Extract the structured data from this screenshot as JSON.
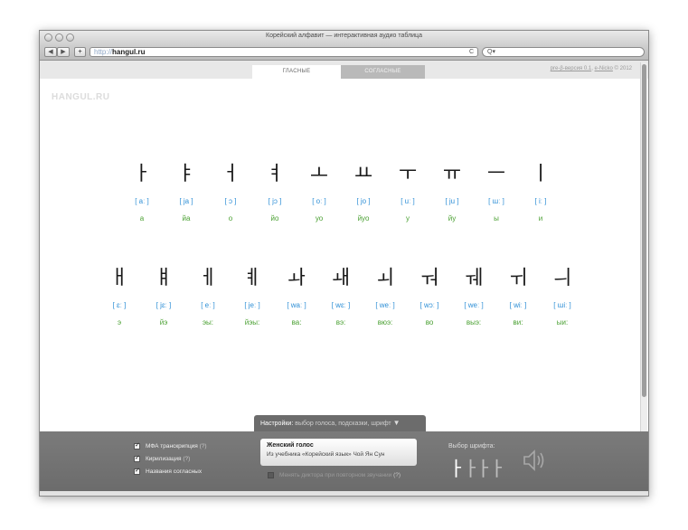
{
  "browser": {
    "window_title": "Корейский алфавит — интерактивная аудио таблица",
    "back_label": "◀",
    "forward_label": "▶",
    "add_label": "+",
    "url_protocol": "http://",
    "url_host": "hangul.ru",
    "reload_label": "C",
    "search_placeholder": "Q▾"
  },
  "header": {
    "tab_vowels": "ГЛАСНЫЕ",
    "tab_consonants": "СОГЛАСНЫЕ",
    "version_link": "pre-β-версия 0.1",
    "version_sep": ", ",
    "author_link": "e-Nicko",
    "copyright": " © 2012",
    "logo": "HANGUL.RU"
  },
  "row1": [
    {
      "jamo": "ㅏ",
      "ipa": "[ aː ]",
      "cyr": "а"
    },
    {
      "jamo": "ㅑ",
      "ipa": "[ ja ]",
      "cyr": "йа"
    },
    {
      "jamo": "ㅓ",
      "ipa": "[ ɔ ]",
      "cyr": "о"
    },
    {
      "jamo": "ㅕ",
      "ipa": "[ jɔ ]",
      "cyr": "йо"
    },
    {
      "jamo": "ㅗ",
      "ipa": "[ oː ]",
      "cyr": "уо"
    },
    {
      "jamo": "ㅛ",
      "ipa": "[ jo ]",
      "cyr": "йуо"
    },
    {
      "jamo": "ㅜ",
      "ipa": "[ uː ]",
      "cyr": "у"
    },
    {
      "jamo": "ㅠ",
      "ipa": "[ ju ]",
      "cyr": "йу"
    },
    {
      "jamo": "ㅡ",
      "ipa": "[ ɯː ]",
      "cyr": "ы"
    },
    {
      "jamo": "ㅣ",
      "ipa": "[ iː ]",
      "cyr": "и"
    }
  ],
  "row2": [
    {
      "jamo": "ㅐ",
      "ipa": "[ ɛː ]",
      "cyr": "э"
    },
    {
      "jamo": "ㅒ",
      "ipa": "[ jɛː ]",
      "cyr": "йэ"
    },
    {
      "jamo": "ㅔ",
      "ipa": "[ eː ]",
      "cyr": "эы:"
    },
    {
      "jamo": "ㅖ",
      "ipa": "[ jeː ]",
      "cyr": "йэы:"
    },
    {
      "jamo": "ㅘ",
      "ipa": "[ waː ]",
      "cyr": "ва:"
    },
    {
      "jamo": "ㅙ",
      "ipa": "[ wɛː ]",
      "cyr": "вэ:"
    },
    {
      "jamo": "ㅚ",
      "ipa": "[ weː ]",
      "cyr": "вюэ:"
    },
    {
      "jamo": "ㅝ",
      "ipa": "[ wɔː ]",
      "cyr": "во"
    },
    {
      "jamo": "ㅞ",
      "ipa": "[ weː ]",
      "cyr": "выэ:"
    },
    {
      "jamo": "ㅟ",
      "ipa": "[ wiː ]",
      "cyr": "ви:"
    },
    {
      "jamo": "ㅢ",
      "ipa": "[ ɯiː ]",
      "cyr": "ыи:"
    }
  ],
  "settings": {
    "tab_label": "Настройки:",
    "tab_sub": " выбор голоса, подсказки, шрифт",
    "tab_arrow": "▼",
    "checkbox_ipa": "МФА транскрипция",
    "checkbox_cyr": "Кирилизация",
    "checkbox_names": "Названия согласных",
    "help_mark": "(?)",
    "voice_title": "Женский голос",
    "voice_sub": "Из учебника «Корейский язык» Чой Ян Сун",
    "change_speaker": "Менять диктора при повторном звучании",
    "font_label": "Выбор шрифта:",
    "font_samples": [
      "ㅏ",
      "ㅏ",
      "ㅏ",
      "ㅏ"
    ]
  },
  "colors": {
    "ipa": "#2e8fd6",
    "cyrillic": "#4aa032",
    "panel": "#6c6c6c"
  }
}
